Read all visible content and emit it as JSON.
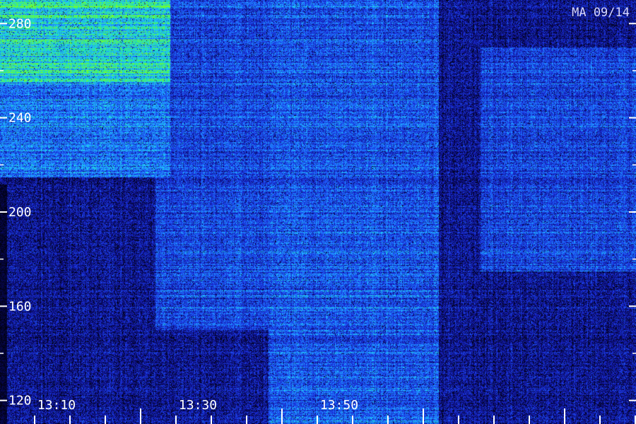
{
  "chart_data": {
    "type": "heatmap",
    "title": "",
    "station_label": "MA 09/14",
    "xlabel": "",
    "ylabel": "",
    "x_axis": {
      "unit": "time",
      "range": [
        "13:02",
        "14:02"
      ],
      "tick_labels": [
        "13:10",
        "13:30",
        "13:50"
      ],
      "tick_label_values_min": [
        8,
        28,
        48
      ],
      "minor_tick_interval_min": 5
    },
    "y_axis": {
      "range": [
        110,
        290
      ],
      "tick_labels": [
        "280",
        "240",
        "200",
        "160",
        "120"
      ],
      "tick_values": [
        280,
        240,
        200,
        160,
        120
      ],
      "minor_tick_values": [
        260,
        220,
        180,
        140
      ]
    },
    "intensity_regions": [
      {
        "t_start_min": 0,
        "t_end_min": 24,
        "f_start": 255,
        "f_end": 290,
        "level": 0.95,
        "desc": "strong early high-frequency band"
      },
      {
        "t_start_min": 0,
        "t_end_min": 24,
        "f_start": 215,
        "f_end": 255,
        "level": 0.6
      },
      {
        "t_start_min": 22,
        "t_end_min": 40,
        "f_start": 150,
        "f_end": 290,
        "level": 0.45
      },
      {
        "t_start_min": 38,
        "t_end_min": 62,
        "f_start": 110,
        "f_end": 290,
        "level": 0.5
      },
      {
        "t_start_min": 68,
        "t_end_min": 90,
        "f_start": 175,
        "f_end": 270,
        "level": 0.45
      }
    ],
    "colormap": [
      "#000000",
      "#0a0a6e",
      "#1a2bd6",
      "#1e6bff",
      "#20c8ff",
      "#22e8a0",
      "#7dff20"
    ],
    "grid": false,
    "legend": "none"
  }
}
